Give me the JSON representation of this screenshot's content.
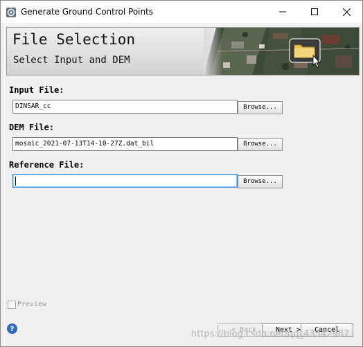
{
  "window": {
    "title": "Generate Ground Control Points"
  },
  "banner": {
    "title": "File Selection",
    "subtitle": "Select Input and DEM",
    "image_icon": "folder-icon"
  },
  "fields": {
    "input": {
      "label": "Input File:",
      "value": "DINSAR_cc",
      "button": "Browse..."
    },
    "dem": {
      "label": "DEM File:",
      "value": "mosaic_2021-07-13T14-10-27Z.dat_bil",
      "button": "Browse..."
    },
    "reference": {
      "label": "Reference File:",
      "value": "",
      "button": "Browse..."
    }
  },
  "preview": {
    "label": "Preview",
    "checked": false
  },
  "footer": {
    "back": "< Back",
    "next": "Next >",
    "cancel": "Cancel"
  },
  "watermark": "https://blog.csdn.net/qq_43542987",
  "colors": {
    "banner_bg": "#d8d8d8",
    "input_focus": "#3b8fd6",
    "disabled_text": "#a8a8a8"
  }
}
